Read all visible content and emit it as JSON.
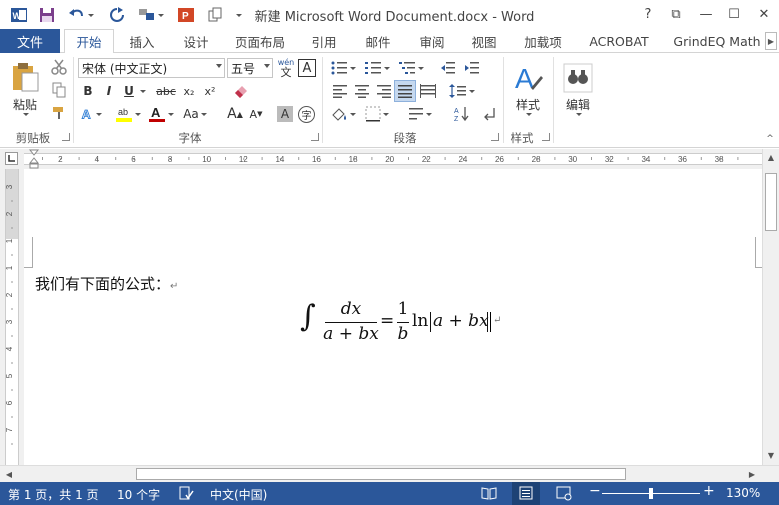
{
  "window": {
    "title": "新建 Microsoft Word Document.docx - Word",
    "help": "?",
    "controls": {
      "restore_ribbon": "⧉",
      "minimize": "—",
      "maximize": "☐",
      "close": "✕"
    }
  },
  "quick_access": {
    "app_icon": "W",
    "powerpoint_icon": "P"
  },
  "tabs": {
    "file": "文件",
    "items": [
      "开始",
      "插入",
      "设计",
      "页面布局",
      "引用",
      "邮件",
      "审阅",
      "视图",
      "加载项",
      "ACROBAT",
      "GrindEQ Math"
    ],
    "active": "开始"
  },
  "ribbon": {
    "clipboard": {
      "paste_label": "粘贴",
      "group_label": "剪贴板"
    },
    "font": {
      "font_name": "宋体 (中文正文)",
      "font_size": "五号",
      "phonetic": "wén",
      "phonetic_glyph": "文",
      "char_border": "A",
      "bold": "B",
      "italic": "I",
      "underline": "U",
      "strike": "abc",
      "subscript": "x₂",
      "superscript": "x²",
      "change_case": "Aa",
      "grow": "A",
      "shrink": "A",
      "char_shading": "A",
      "enclose": "字",
      "group_label": "字体"
    },
    "paragraph": {
      "group_label": "段落"
    },
    "styles": {
      "label": "样式",
      "group_label": "样式"
    },
    "editing": {
      "label": "编辑"
    }
  },
  "ruler": {
    "h_ticks": [
      "2",
      "4",
      "6",
      "8",
      "10",
      "12",
      "14",
      "16",
      "18",
      "20",
      "22",
      "24",
      "26",
      "28",
      "30",
      "32",
      "34",
      "36",
      "38"
    ],
    "v_ticks": [
      "3",
      "2",
      "1",
      "1",
      "2",
      "3",
      "4",
      "5",
      "6",
      "7"
    ]
  },
  "document": {
    "paragraph_text": "我们有下面的公式：",
    "paragraph_mark": "↵",
    "formula": {
      "integral": "∫",
      "numerator": "dx",
      "denominator": "a + bx",
      "equals": "=",
      "coef_numerator": "1",
      "coef_denominator": "b",
      "func": "ln",
      "abs_content": "a + bx"
    }
  },
  "status_bar": {
    "page": "第 1 页，共 1 页",
    "words": "10 个字",
    "language": "中文(中国)",
    "zoom_minus": "−",
    "zoom_plus": "+",
    "zoom": "130%",
    "zoom_fraction": 0.5
  },
  "colors": {
    "accent": "#2b579a",
    "highlight": "#ffff00",
    "font_color": "#c00000"
  }
}
